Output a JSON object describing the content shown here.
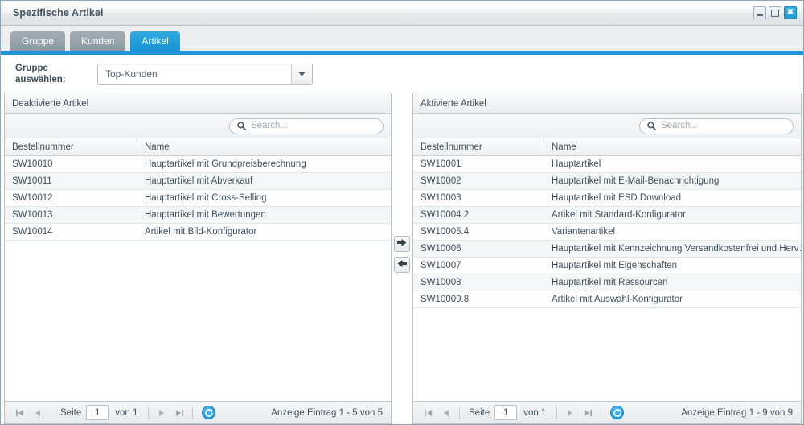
{
  "window": {
    "title": "Spezifische Artikel",
    "buttons": {
      "minimize": "minimize-icon",
      "maximize": "maximize-icon",
      "close": "✖"
    }
  },
  "tabs": [
    {
      "label": "Gruppe",
      "active": false
    },
    {
      "label": "Kunden",
      "active": false
    },
    {
      "label": "Artikel",
      "active": true
    }
  ],
  "selector": {
    "label_line1": "Gruppe",
    "label_line2": "auswählen:",
    "value": "Top-Kunden"
  },
  "transfer": {
    "to_right": "arrow-right-icon",
    "to_left": "arrow-left-icon"
  },
  "left_panel": {
    "header": "Deaktivierte Artikel",
    "search_placeholder": "Search...",
    "search_value": "",
    "columns": [
      "Bestellnummer",
      "Name"
    ],
    "rows": [
      {
        "nr": "SW10010",
        "name": "Hauptartikel mit Grundpreisberechnung"
      },
      {
        "nr": "SW10011",
        "name": "Hauptartikel mit Abverkauf"
      },
      {
        "nr": "SW10012",
        "name": "Hauptartikel mit Cross-Selling"
      },
      {
        "nr": "SW10013",
        "name": "Hauptartikel mit Bewertungen"
      },
      {
        "nr": "SW10014",
        "name": "Artikel mit Bild-Konfigurator"
      }
    ],
    "pager": {
      "page_label": "Seite",
      "page_value": "1",
      "of_label": "von 1",
      "status": "Anzeige Eintrag 1 - 5 von 5"
    }
  },
  "right_panel": {
    "header": "Aktivierte Artikel",
    "search_placeholder": "Search...",
    "search_value": "",
    "columns": [
      "Bestellnummer",
      "Name"
    ],
    "rows": [
      {
        "nr": "SW10001",
        "name": "Hauptartikel"
      },
      {
        "nr": "SW10002",
        "name": "Hauptartikel mit E-Mail-Benachrichtigung"
      },
      {
        "nr": "SW10003",
        "name": "Hauptartikel mit ESD Download"
      },
      {
        "nr": "SW10004.2",
        "name": "Artikel mit Standard-Konfigurator"
      },
      {
        "nr": "SW10005.4",
        "name": "Variantenartikel"
      },
      {
        "nr": "SW10006",
        "name": "Hauptartikel mit Kennzeichnung Versandkostenfrei und Herv…"
      },
      {
        "nr": "SW10007",
        "name": "Hauptartikel mit Eigenschaften"
      },
      {
        "nr": "SW10008",
        "name": "Hauptartikel mit Ressourcen"
      },
      {
        "nr": "SW10009.8",
        "name": "Artikel mit Auswahl-Konfigurator"
      }
    ],
    "pager": {
      "page_label": "Seite",
      "page_value": "1",
      "of_label": "von 1",
      "status": "Anzeige Eintrag 1 - 9 von 9"
    }
  },
  "colors": {
    "accent_blue": "#1e96d7",
    "tab_inactive": "#98a3ab",
    "text": "#41505c",
    "panel_border": "#b9c3cb"
  }
}
